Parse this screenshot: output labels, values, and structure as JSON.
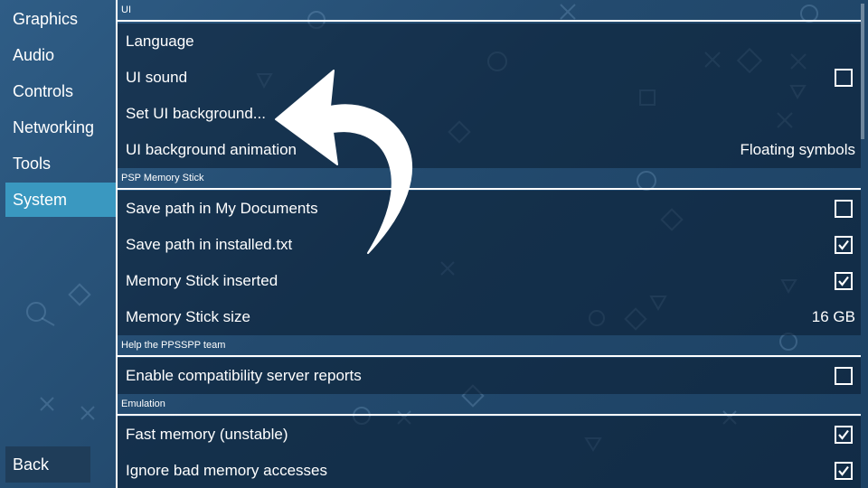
{
  "sidebar": {
    "tabs": [
      {
        "label": "Graphics"
      },
      {
        "label": "Audio"
      },
      {
        "label": "Controls"
      },
      {
        "label": "Networking"
      },
      {
        "label": "Tools"
      },
      {
        "label": "System"
      }
    ],
    "active_tab": "System",
    "back_label": "Back"
  },
  "sections": {
    "ui": {
      "header": "UI",
      "language": {
        "label": "Language"
      },
      "ui_sound": {
        "label": "UI sound",
        "checked": false
      },
      "set_background": {
        "label": "Set UI background..."
      },
      "background_animation": {
        "label": "UI background animation",
        "value": "Floating symbols"
      }
    },
    "memstick": {
      "header": "PSP Memory Stick",
      "save_my_documents": {
        "label": "Save path in My Documents",
        "checked": false
      },
      "save_installed": {
        "label": "Save path in installed.txt",
        "checked": true
      },
      "inserted": {
        "label": "Memory Stick inserted",
        "checked": true
      },
      "size": {
        "label": "Memory Stick size",
        "value": "16 GB"
      }
    },
    "help": {
      "header": "Help the PPSSPP team",
      "compat_reports": {
        "label": "Enable compatibility server reports",
        "checked": false
      }
    },
    "emulation": {
      "header": "Emulation",
      "fast_memory": {
        "label": "Fast memory (unstable)",
        "checked": true
      },
      "ignore_bad_memory": {
        "label": "Ignore bad memory accesses",
        "checked": true
      }
    }
  },
  "colors": {
    "active_tab": "#3a98c0",
    "background": "#234a6e",
    "row_background": "#0a1c30"
  },
  "icons": {
    "checkbox_checked": "checkmark-icon",
    "annotation": "curved-arrow-icon"
  }
}
